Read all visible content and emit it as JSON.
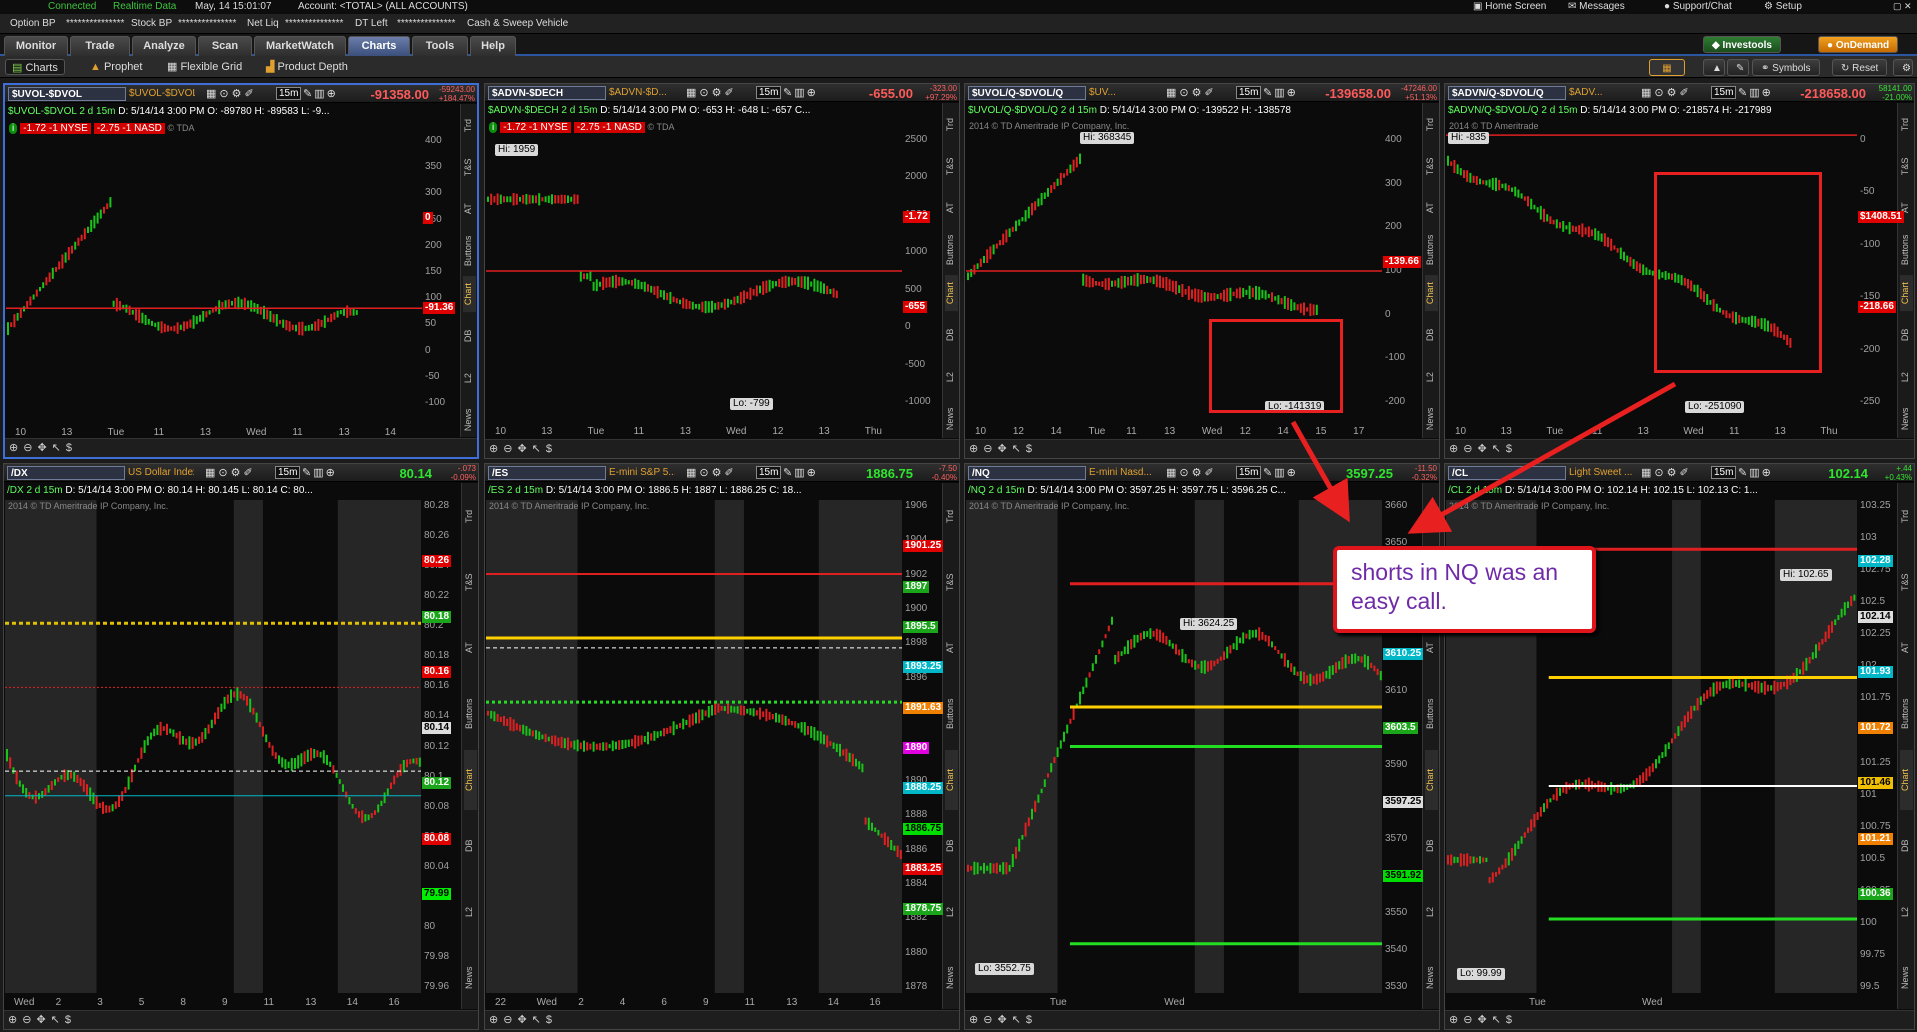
{
  "status": {
    "connected": "Connected",
    "realtime": "Realtime Data",
    "datetime": "May, 14 15:01:07",
    "account": "Account: <TOTAL> (ALL ACCOUNTS)"
  },
  "topright": {
    "home": "Home Screen",
    "messages": "Messages",
    "support": "Support/Chat",
    "setup": "Setup"
  },
  "acct": {
    "option_bp": "Option BP",
    "option_bp_val": "***************",
    "stock_bp": "Stock BP",
    "stock_bp_val": "***************",
    "net_liq": "Net Liq",
    "net_liq_val": "***************",
    "dt_left": "DT Left",
    "dt_left_val": "***************",
    "cash": "Cash & Sweep Vehicle"
  },
  "tabs": [
    "Monitor",
    "Trade",
    "Analyze",
    "Scan",
    "MarketWatch",
    "Charts",
    "Tools",
    "Help"
  ],
  "right_tabs": {
    "investools": "Investools",
    "ondemand": "OnDemand"
  },
  "subnav": [
    "Charts",
    "Prophet",
    "Flexible Grid",
    "Product Depth"
  ],
  "subnav_right": {
    "symbols": "Symbols",
    "reset": "Reset"
  },
  "side_tabs": [
    "Trd",
    "T&S",
    "AT",
    "Buttons",
    "Chart",
    "DB",
    "L2",
    "News"
  ],
  "charts": [
    {
      "symbol": "$UVOL-$DVOL",
      "desc": "$UVOL-$DVOL",
      "tf": "15m",
      "last": "-91358.00",
      "chg_top": "-59243.00",
      "chg_bot": "+184.47%",
      "info_title": "$UVOL-$DVOL 2 d 15m",
      "info": "D: 5/14/14 3:00 PM  O: -89780  H: -89583  L: -9...",
      "badge_a": "-1.72 -1 NYSE",
      "badge_b": "-2.75 -1 NASD",
      "watermark": "2014 © TDA",
      "hi": "",
      "lo": "",
      "yticks": [
        "400",
        "350",
        "300",
        "250",
        "200",
        "150",
        "100",
        "50",
        "0",
        "-50",
        "-100"
      ],
      "ylabels": [
        {
          "v": "0",
          "c": "#e00000"
        },
        {
          "v": "-91.36",
          "c": "#e00000"
        }
      ],
      "xticks": [
        "10",
        "13",
        "Tue",
        "11",
        "13",
        "Wed",
        "11",
        "13",
        "14"
      ]
    },
    {
      "symbol": "$ADVN-$DECH",
      "desc": "$ADVN-$D...",
      "tf": "15m",
      "last": "-655.00",
      "chg_top": "-323.00",
      "chg_bot": "+97.29%",
      "info_title": "$ADVN-$DECH 2 d 15m",
      "info": "D: 5/14/14 3:00 PM  O: -653  H: -648  L: -657  C...",
      "badge_a": "-1.72 -1 NYSE",
      "badge_b": "-2.75 -1 NASD",
      "watermark": "2014 © TDA",
      "hi": "Hi: 1959",
      "lo": "Lo: -799",
      "yticks": [
        "2500",
        "2000",
        "1500",
        "1000",
        "500",
        "0",
        "-500",
        "-1000"
      ],
      "ylabels": [
        {
          "v": "-1.72",
          "c": "#e00000"
        },
        {
          "v": "-655",
          "c": "#e00000"
        }
      ],
      "xticks": [
        "10",
        "13",
        "Tue",
        "11",
        "13",
        "Wed",
        "12",
        "13",
        "Thu"
      ]
    },
    {
      "symbol": "$UVOL/Q-$DVOL/Q",
      "desc": "$UV...",
      "tf": "15m",
      "last": "-139658.00",
      "chg_top": "-47246.00",
      "chg_bot": "+51.13%",
      "info_title": "$UVOL/Q-$DVOL/Q 2 d 15m",
      "info": "D: 5/14/14 3:00 PM  O: -139522  H: -138578",
      "badge_a": "",
      "badge_b": "",
      "watermark": "2014 © TD Ameritrade IP Company, Inc.",
      "hi": "Hi: 368345",
      "lo": "Lo: -141319",
      "yticks": [
        "400",
        "300",
        "200",
        "100",
        "0",
        "-100",
        "-200"
      ],
      "ylabels": [
        {
          "v": "-139.66",
          "c": "#e00000"
        }
      ],
      "xticks": [
        "10",
        "12",
        "14",
        "Tue",
        "11",
        "13",
        "Wed",
        "12",
        "14",
        "15",
        "17"
      ]
    },
    {
      "symbol": "$ADVN/Q-$DVOL/Q",
      "desc": "$ADV...",
      "tf": "15m",
      "last": "-218658.00",
      "chg_top": "58141.00",
      "chg_bot": "-21.00%",
      "info_title": "$ADVN/Q-$DVOL/Q 2 d 15m",
      "info": "D: 5/14/14 3:00 PM  O: -218574  H: -217989",
      "badge_a": "",
      "badge_b": "",
      "watermark": "2014 © TD Ameritrade",
      "hi": "Hi: -835",
      "lo": "Lo: -251090",
      "yticks": [
        "0",
        "-50",
        "-100",
        "-150",
        "-200",
        "-250"
      ],
      "ylabels": [
        {
          "v": "$1408.51",
          "c": "#e00000"
        },
        {
          "v": "-218.66",
          "c": "#e00000"
        }
      ],
      "xticks": [
        "10",
        "13",
        "Tue",
        "11",
        "13",
        "Wed",
        "11",
        "13",
        "Thu"
      ]
    },
    {
      "symbol": "/DX",
      "desc": "US Dollar Index",
      "tf": "15m",
      "last": "80.14",
      "chg_top": "-.073",
      "chg_bot": "-0.09%",
      "info_title": "/DX 2 d 15m",
      "info": "D: 5/14/14 3:00 PM  O: 80.14  H: 80.145  L: 80.14  C: 80...",
      "badge_a": "",
      "badge_b": "",
      "watermark": "2014 © TD Ameritrade IP Company, Inc.",
      "hi": "",
      "lo": "",
      "yticks": [
        "80.28",
        "80.26",
        "80.24",
        "80.22",
        "80.2",
        "80.18",
        "80.16",
        "80.14",
        "80.12",
        "80.1",
        "80.08",
        "80.06",
        "80.04",
        "80.02",
        "80",
        "79.98",
        "79.96"
      ],
      "ylabels": [
        {
          "v": "80.26",
          "c": "#e00000"
        },
        {
          "v": "80.18",
          "c": "#1aa51a"
        },
        {
          "v": "80.16",
          "c": "#e00000"
        },
        {
          "v": "80.14",
          "c": "#dddddd"
        },
        {
          "v": "80.12",
          "c": "#1aa51a"
        },
        {
          "v": "80.08",
          "c": "#e00000"
        },
        {
          "v": "79.99",
          "c": "#00ee00"
        }
      ],
      "xticks": [
        "Wed",
        "2",
        "3",
        "5",
        "8",
        "9",
        "11",
        "13",
        "14",
        "16"
      ]
    },
    {
      "symbol": "/ES",
      "desc": "E-mini S&P 5...",
      "tf": "15m",
      "last": "1886.75",
      "chg_top": "-7.50",
      "chg_bot": "-0.40%",
      "info_title": "/ES 2 d 15m",
      "info": "D: 5/14/14 3:00 PM  O: 1886.5  H: 1887  L: 1886.25  C: 18...",
      "badge_a": "",
      "badge_b": "",
      "watermark": "2014 © TD Ameritrade IP Company, Inc.",
      "hi": "",
      "lo": "",
      "yticks": [
        "1906",
        "1904",
        "1902",
        "1900",
        "1898",
        "1896",
        "1894",
        "1892",
        "1890",
        "1888",
        "1886",
        "1884",
        "1882",
        "1880",
        "1878"
      ],
      "ylabels": [
        {
          "v": "1901.25",
          "c": "#e00000"
        },
        {
          "v": "1897",
          "c": "#1aa51a"
        },
        {
          "v": "1895.5",
          "c": "#1aa51a"
        },
        {
          "v": "1893.25",
          "c": "#00b7c8"
        },
        {
          "v": "1891.63",
          "c": "#f08000"
        },
        {
          "v": "1890",
          "c": "#e000e0"
        },
        {
          "v": "1888.25",
          "c": "#00b7c8"
        },
        {
          "v": "1886.75",
          "c": "#00dd00"
        },
        {
          "v": "1883.25",
          "c": "#e00000"
        },
        {
          "v": "1878.75",
          "c": "#1aa51a"
        }
      ],
      "xticks": [
        "22",
        "Wed",
        "2",
        "4",
        "6",
        "9",
        "11",
        "13",
        "14",
        "16"
      ]
    },
    {
      "symbol": "/NQ",
      "desc": "E-mini Nasd...",
      "tf": "15m",
      "last": "3597.25",
      "chg_top": "-11.50",
      "chg_bot": "-0.32%",
      "info_title": "/NQ 2 d 15m",
      "info": "D: 5/14/14 3:00 PM  O: 3597.25  H: 3597.75  L: 3596.25  C...",
      "badge_a": "",
      "badge_b": "",
      "watermark": "2014 © TD Ameritrade IP Company, Inc.",
      "hi": "Hi: 3624.25",
      "lo": "Lo: 3552.75",
      "yticks": [
        "3660",
        "3650",
        "3640",
        "3630",
        "3620",
        "3610",
        "3600",
        "3590",
        "3580",
        "3570",
        "3560",
        "3550",
        "3540",
        "3530"
      ],
      "ylabels": [
        {
          "v": "3624.25",
          "c": "#e00000"
        },
        {
          "v": "3610.25",
          "c": "#00b7c8"
        },
        {
          "v": "3603.5",
          "c": "#1aa51a"
        },
        {
          "v": "3597.25",
          "c": "#dddddd"
        },
        {
          "v": "3591.92",
          "c": "#00dd00"
        }
      ],
      "xticks": [
        "Tue",
        "Wed"
      ]
    },
    {
      "symbol": "/CL",
      "desc": "Light Sweet ...",
      "tf": "15m",
      "last": "102.14",
      "chg_top": "+.44",
      "chg_bot": "+0.43%",
      "info_title": "/CL 2 d 15m",
      "info": "D: 5/14/14 3:00 PM  O: 102.14  H: 102.15  L: 102.13  C: 1...",
      "badge_a": "",
      "badge_b": "",
      "watermark": "2014 © TD Ameritrade IP Company, Inc.",
      "hi": "Hi: 102.65",
      "lo": "Lo: 99.99",
      "yticks": [
        "103.25",
        "103",
        "102.75",
        "102.5",
        "102.25",
        "102",
        "101.75",
        "101.5",
        "101.25",
        "101",
        "100.75",
        "100.5",
        "100.25",
        "100",
        "99.75",
        "99.5"
      ],
      "ylabels": [
        {
          "v": "102.28",
          "c": "#00b7c8"
        },
        {
          "v": "102.14",
          "c": "#dddddd"
        },
        {
          "v": "101.93",
          "c": "#00b7c8"
        },
        {
          "v": "101.72",
          "c": "#f08000"
        },
        {
          "v": "101.46",
          "c": "#f0c000"
        },
        {
          "v": "101.21",
          "c": "#f08000"
        },
        {
          "v": "100.36",
          "c": "#1aa51a"
        }
      ],
      "xticks": [
        "Tue",
        "Wed"
      ]
    }
  ],
  "callout": {
    "text": "shorts in NQ was an easy call."
  }
}
